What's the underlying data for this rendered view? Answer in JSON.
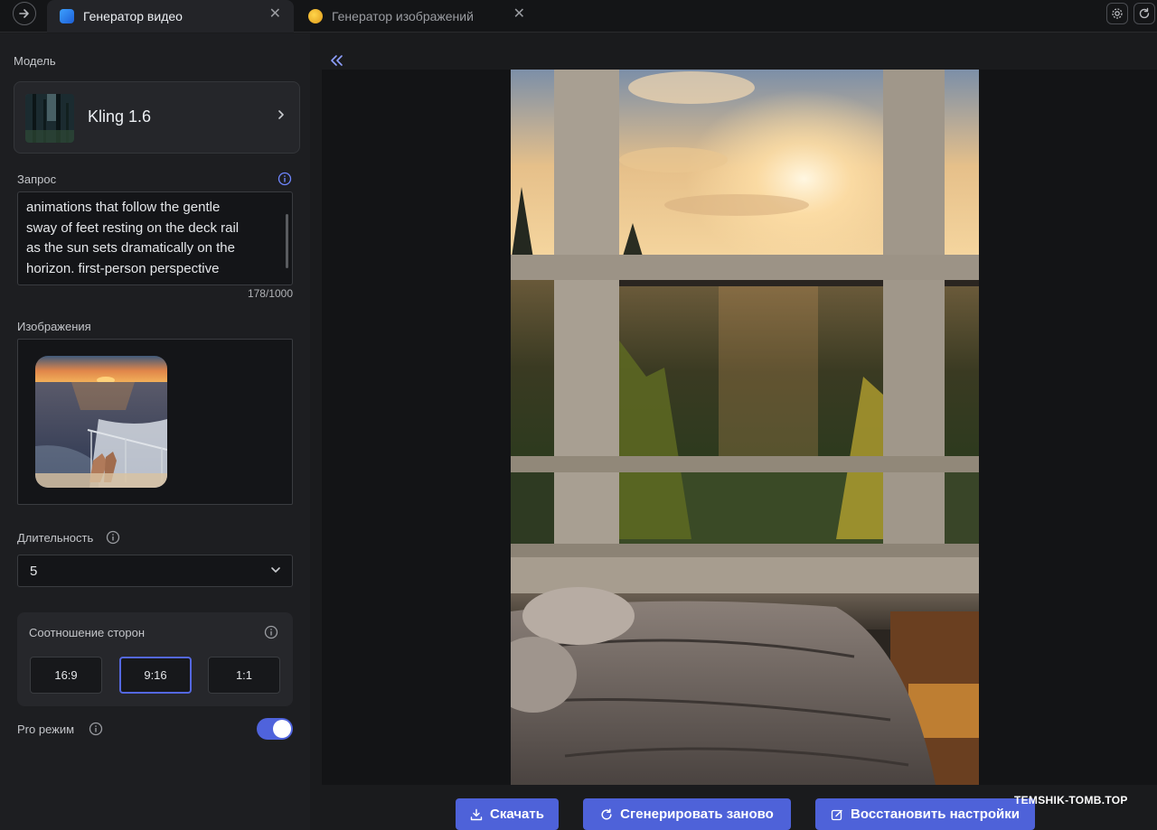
{
  "tabs": [
    {
      "label": "Генератор видео",
      "active": true
    },
    {
      "label": "Генератор изображений",
      "active": false
    }
  ],
  "sidebar": {
    "model_label": "Модель",
    "model_name": "Kling 1.6",
    "prompt_label": "Запрос",
    "prompt_lines": [
      "animations that follow the gentle",
      "sway of feet resting on the deck rail",
      "as the sun sets dramatically on the",
      "horizon. first-person perspective"
    ],
    "prompt_counter": "178/1000",
    "images_label": "Изображения",
    "duration_label": "Длительность",
    "duration_value": "5",
    "aspect_label": "Соотношение сторон",
    "aspect_options": [
      "16:9",
      "9:16",
      "1:1"
    ],
    "aspect_selected": "9:16",
    "pro_label": "Pro режим",
    "pro_enabled": true
  },
  "actions": {
    "download": "Скачать",
    "regenerate": "Сгенерировать заново",
    "restore": "Восстановить настройки"
  },
  "watermark": "TEMSHIK-TOMB.TOP",
  "colors": {
    "accent": "#4e62d9",
    "panel": "#1d1e21",
    "canvas": "#131416"
  }
}
